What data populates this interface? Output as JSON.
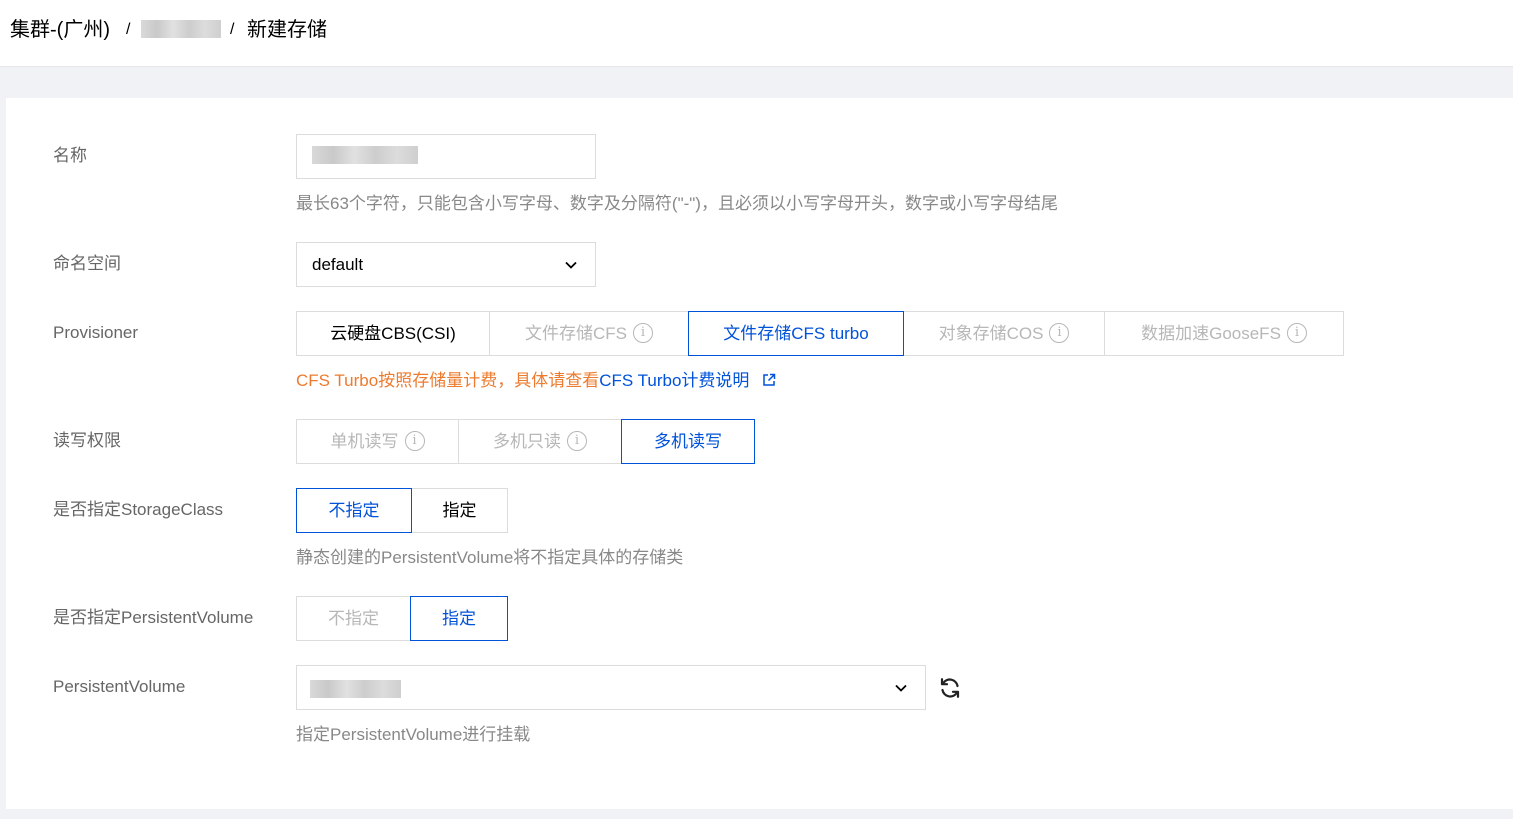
{
  "breadcrumb": {
    "cluster": "集群-(广州)",
    "separator1": "/",
    "separator2": "/",
    "current": "新建存储"
  },
  "form": {
    "name": {
      "label": "名称",
      "hint": "最长63个字符，只能包含小写字母、数字及分隔符(\"-\")，且必须以小写字母开头，数字或小写字母结尾"
    },
    "namespace": {
      "label": "命名空间",
      "value": "default"
    },
    "provisioner": {
      "label": "Provisioner",
      "options": [
        "云硬盘CBS(CSI)",
        "文件存储CFS",
        "文件存储CFS turbo",
        "对象存储COS",
        "数据加速GooseFS"
      ],
      "selected": "文件存储CFS turbo",
      "note_prefix": "CFS Turbo按照存储量计费，具体请查看",
      "note_link": "CFS Turbo计费说明"
    },
    "access_mode": {
      "label": "读写权限",
      "options": [
        "单机读写",
        "多机只读",
        "多机读写"
      ],
      "selected": "多机读写"
    },
    "storage_class": {
      "label": "是否指定StorageClass",
      "options": [
        "不指定",
        "指定"
      ],
      "selected": "不指定",
      "hint": "静态创建的PersistentVolume将不指定具体的存储类"
    },
    "persistent_volume_toggle": {
      "label": "是否指定PersistentVolume",
      "options": [
        "不指定",
        "指定"
      ],
      "selected": "指定"
    },
    "persistent_volume": {
      "label": "PersistentVolume",
      "hint": "指定PersistentVolume进行挂载"
    }
  },
  "colors": {
    "primary": "#0052d9",
    "warning": "#ed7b2f",
    "label": "#666666",
    "hint": "#888888",
    "disabled": "#b7b7b7"
  },
  "icons": {
    "info": "info-circle-icon",
    "chevron": "chevron-down-icon",
    "refresh": "refresh-icon",
    "external": "external-link-icon"
  }
}
